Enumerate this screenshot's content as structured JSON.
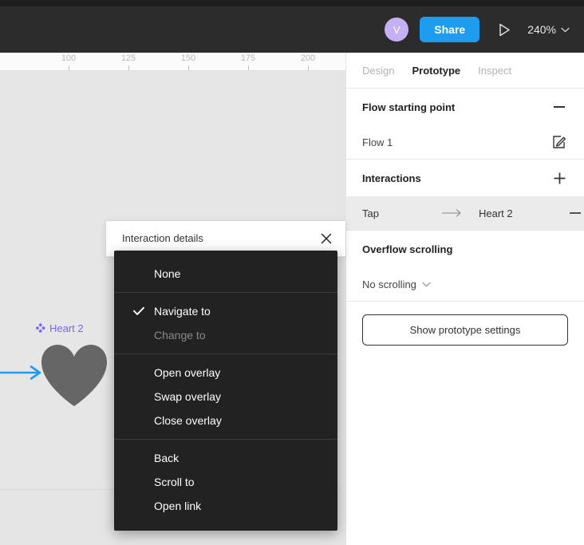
{
  "toolbar": {
    "avatar_initial": "V",
    "share_label": "Share",
    "play_icon": "play-icon",
    "zoom_level": "240%",
    "zoom_chevron_icon": "chevron-down-icon",
    "background_color": "#2c2c2c",
    "share_color": "#1e9cf0",
    "avatar_color": "#c6b0f5"
  },
  "canvas": {
    "ruler_ticks": [
      "100",
      "125",
      "150",
      "175",
      "200"
    ],
    "component_label": "Heart 2",
    "component_icon": "component-diamond-icon",
    "component_color": "#7b61ff",
    "shape_name": "heart-shape",
    "shape_color": "#666666",
    "prototype_arrow_color": "#1e9cf0",
    "background_color": "#e5e5e5"
  },
  "popover": {
    "title": "Interaction details",
    "close_icon": "close-icon"
  },
  "menu": {
    "groups": [
      {
        "items": [
          {
            "label": "None",
            "checked": false,
            "disabled": false
          }
        ]
      },
      {
        "items": [
          {
            "label": "Navigate to",
            "checked": true,
            "disabled": false
          },
          {
            "label": "Change to",
            "checked": false,
            "disabled": true
          }
        ]
      },
      {
        "items": [
          {
            "label": "Open overlay",
            "checked": false,
            "disabled": false
          },
          {
            "label": "Swap overlay",
            "checked": false,
            "disabled": false
          },
          {
            "label": "Close overlay",
            "checked": false,
            "disabled": false
          }
        ]
      },
      {
        "items": [
          {
            "label": "Back",
            "checked": false,
            "disabled": false
          },
          {
            "label": "Scroll to",
            "checked": false,
            "disabled": false
          },
          {
            "label": "Open link",
            "checked": false,
            "disabled": false
          }
        ]
      }
    ],
    "check_icon": "check-icon",
    "background_color": "#222222"
  },
  "right_panel": {
    "tabs": [
      {
        "label": "Design",
        "active": false
      },
      {
        "label": "Prototype",
        "active": true
      },
      {
        "label": "Inspect",
        "active": false
      }
    ],
    "flow_section": {
      "title": "Flow starting point",
      "collapse_icon": "minus-icon",
      "flow_name": "Flow 1",
      "edit_icon": "edit-pencil-icon"
    },
    "interactions_section": {
      "title": "Interactions",
      "add_icon": "plus-icon",
      "trigger": "Tap",
      "arrow_icon": "arrow-right-icon",
      "target": "Heart 2",
      "remove_icon": "minus-icon"
    },
    "overflow_section": {
      "title": "Overflow scrolling",
      "value": "No scrolling",
      "chevron_icon": "chevron-down-icon"
    },
    "settings_button": "Show prototype settings"
  }
}
